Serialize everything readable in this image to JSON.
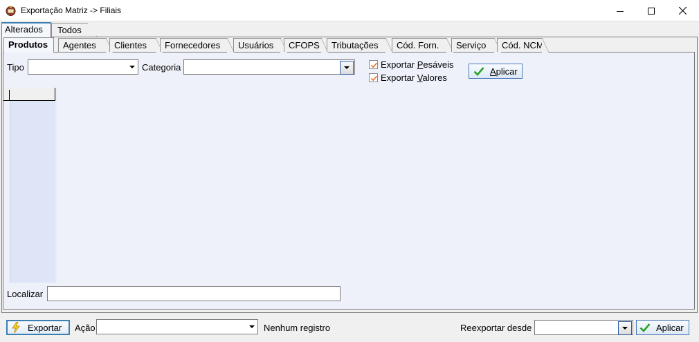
{
  "window": {
    "title": "Exportação Matriz -> Filiais"
  },
  "outer_tabs": [
    {
      "label": "Alterados"
    },
    {
      "label": "Todos"
    }
  ],
  "inner_tabs": [
    {
      "label": "Produtos"
    },
    {
      "label": "Agentes"
    },
    {
      "label": "Clientes"
    },
    {
      "label": "Fornecedores"
    },
    {
      "label": "Usuários"
    },
    {
      "label": "CFOPS"
    },
    {
      "label": "Tributações"
    },
    {
      "label": "Cód. Forn."
    },
    {
      "label": "Serviço"
    },
    {
      "label": "Cód. NCM"
    }
  ],
  "filters": {
    "tipo_label": "Tipo",
    "tipo_value": "",
    "categoria_label": "Categoria",
    "categoria_value": "",
    "exportar_pesaveis": {
      "label_pre": "Exportar ",
      "accel": "P",
      "label_post": "esáveis",
      "checked": true
    },
    "exportar_valores": {
      "label_pre": "Exportar ",
      "accel": "V",
      "label_post": "alores",
      "checked": true
    },
    "apply_accel": "A",
    "apply_rest": "plicar"
  },
  "search": {
    "label": "Localizar",
    "value": ""
  },
  "footer": {
    "export_button": "Exportar",
    "acao_label": "Ação",
    "acao_value": "",
    "status": "Nenhum registro",
    "reexport_label": "Reexportar desde",
    "reexport_value": "",
    "apply_button": "Aplicar"
  },
  "colors": {
    "accent": "#3c7fb1",
    "panel": "#eef1fa",
    "indicator": "#dde5f6",
    "check": "#e8742a",
    "ok_green": "#2aa02a"
  },
  "icons": [
    "app-icon",
    "minimize-icon",
    "maximize-icon",
    "close-icon",
    "checkmark-icon",
    "lightning-icon",
    "chevron-down-icon"
  ]
}
